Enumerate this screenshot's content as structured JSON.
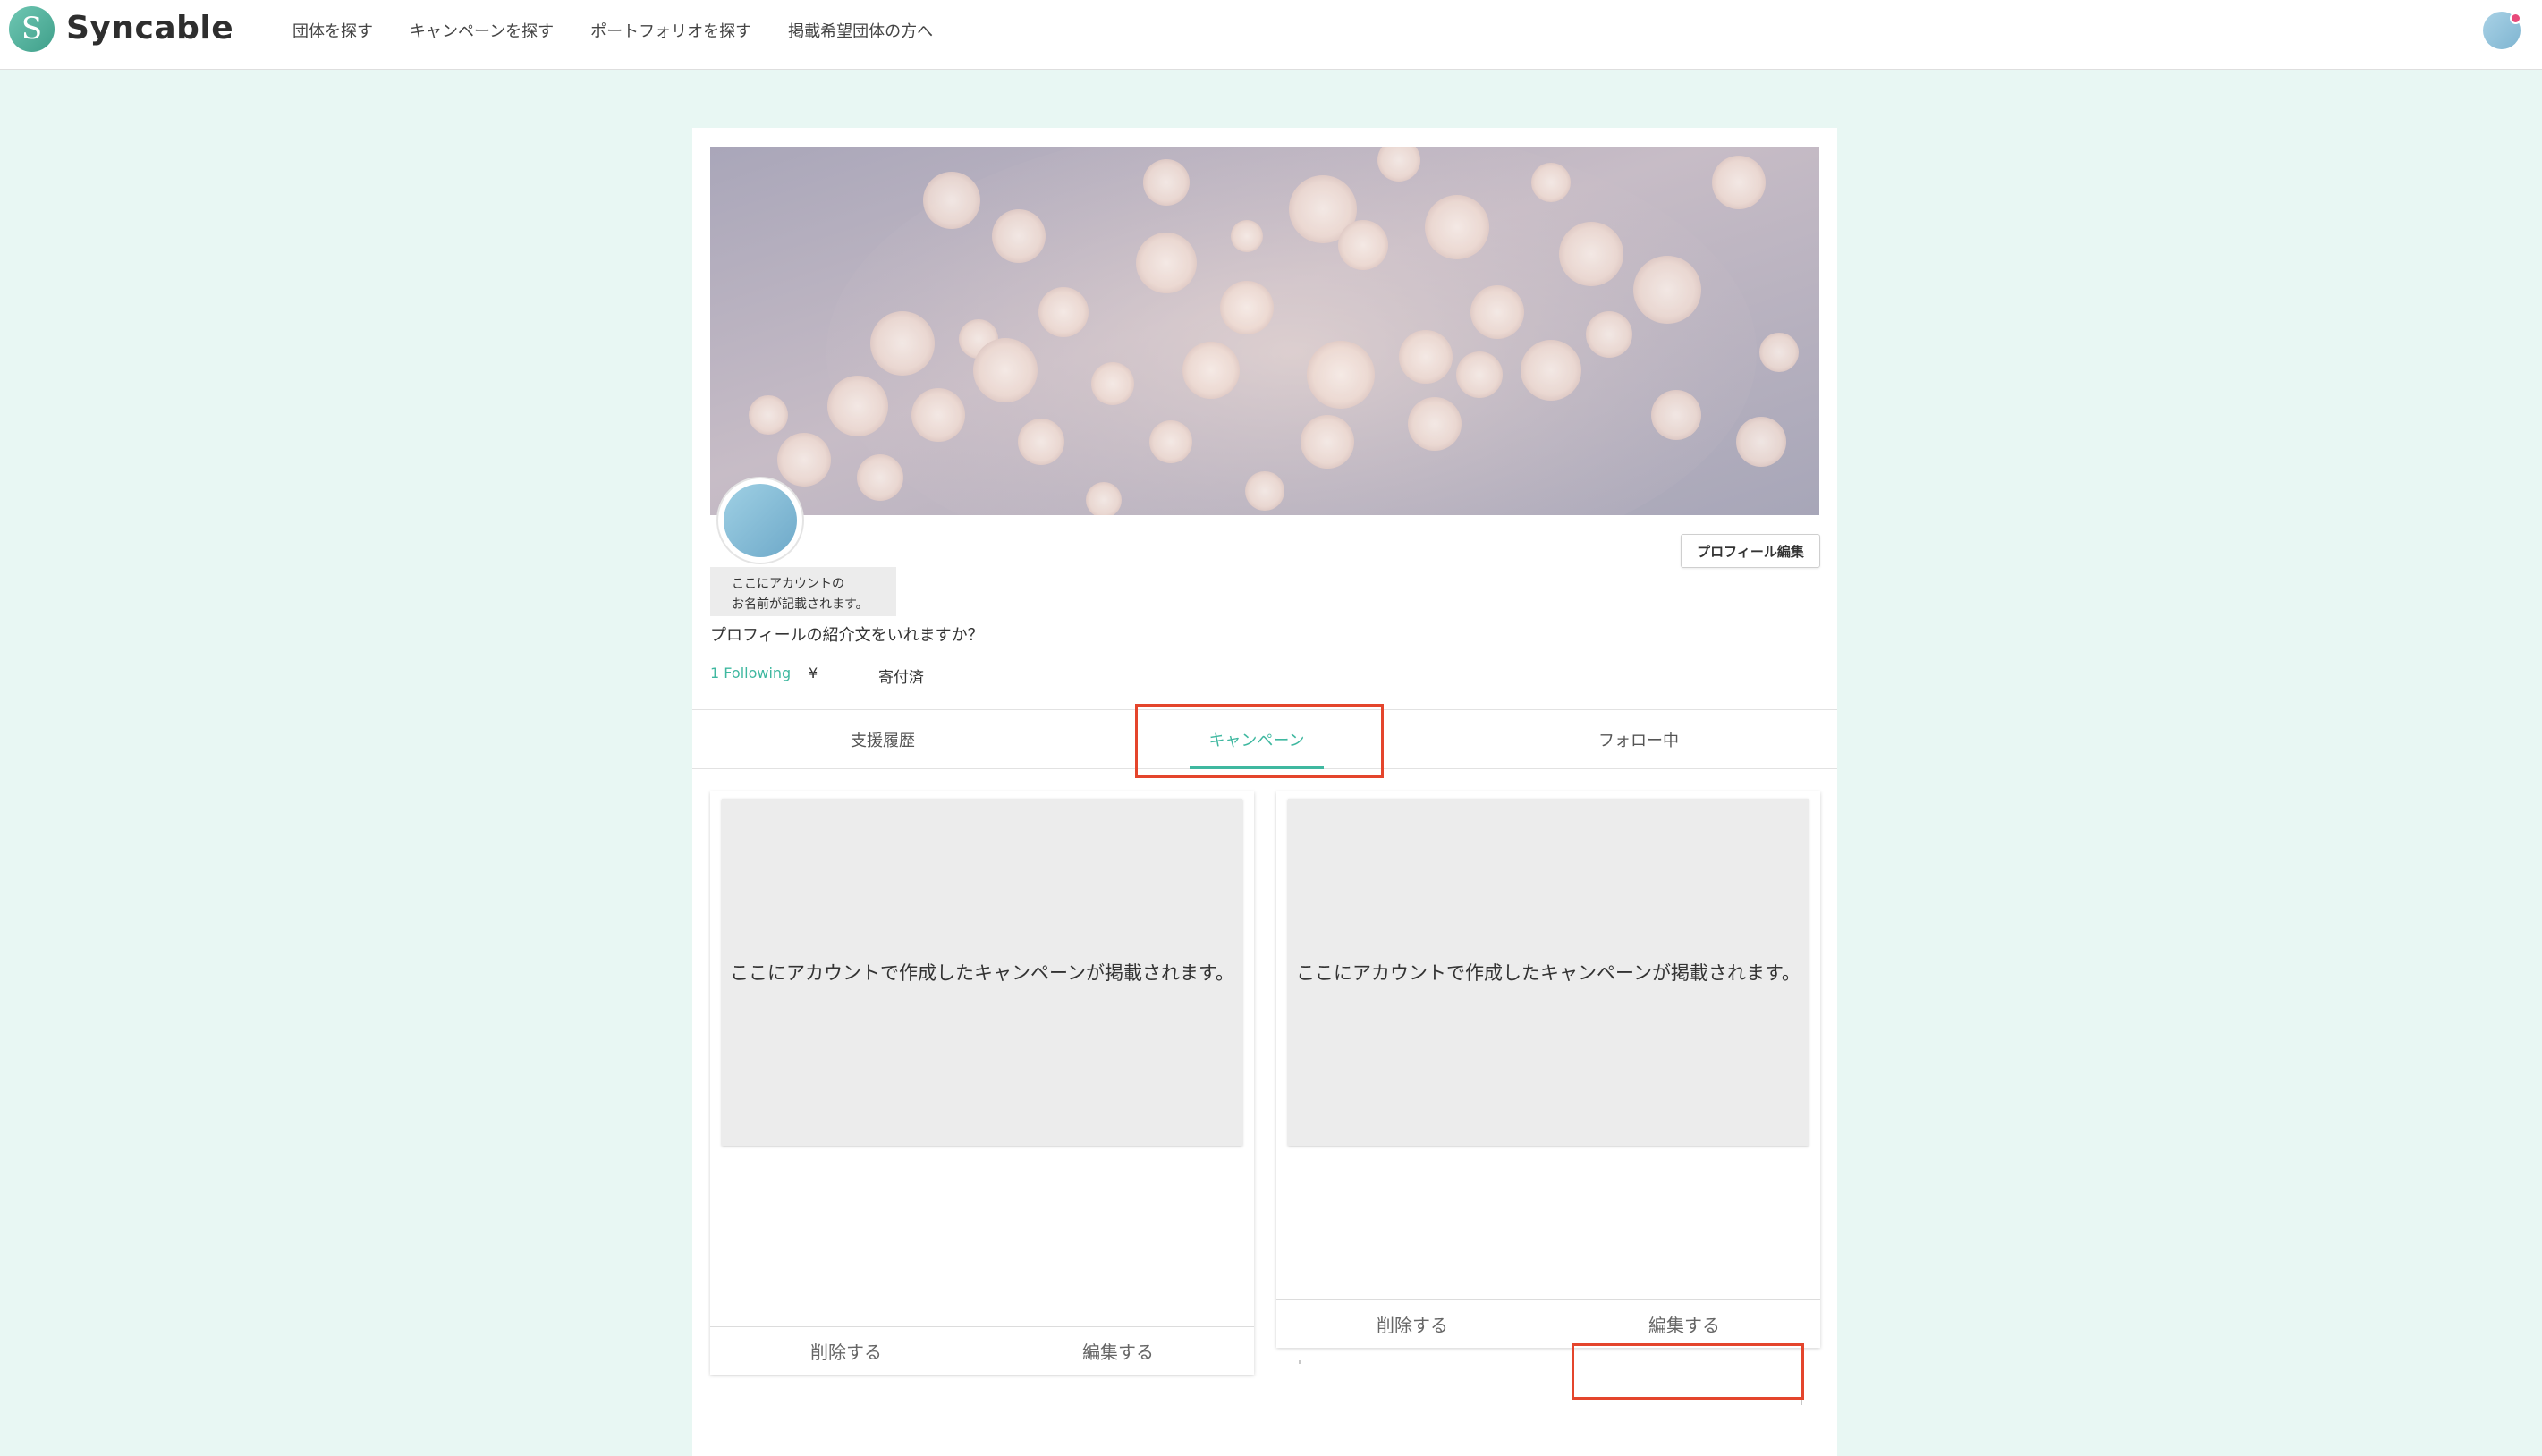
{
  "header": {
    "logo_letter": "S",
    "logo_text": "Syncable",
    "nav": [
      {
        "label": "団体を探す"
      },
      {
        "label": "キャンペーンを探す"
      },
      {
        "label": "ポートフォリオを探す"
      },
      {
        "label": "掲載希望団体の方へ"
      }
    ]
  },
  "profile": {
    "edit_button": "プロフィール編集",
    "name_line1": "ここにアカウントの",
    "name_line2": "お名前が記載されます。",
    "bio": "プロフィールの紹介文をいれますか？",
    "following": "1 Following",
    "yen": "¥",
    "donated": "寄付済"
  },
  "tabs": [
    {
      "label": "支援履歴",
      "active": false
    },
    {
      "label": "キャンペーン",
      "active": true
    },
    {
      "label": "フォロー中",
      "active": false
    }
  ],
  "cards": [
    {
      "placeholder": "ここにアカウントで作成したキャンペーンが掲載されます。",
      "delete_label": "削除する",
      "edit_label": "編集する"
    },
    {
      "placeholder": "ここにアカウントで作成したキャンペーンが掲載されます。",
      "delete_label": "削除する",
      "edit_label": "編集する"
    }
  ],
  "colors": {
    "accent": "#3fb8a0",
    "page_background": "#e8f7f3",
    "highlight": "#e4452c",
    "notification": "#e84a7a"
  },
  "icons": {
    "logo": "syncable-logo-icon",
    "user": "user-avatar-icon",
    "notification": "notification-dot-icon"
  }
}
